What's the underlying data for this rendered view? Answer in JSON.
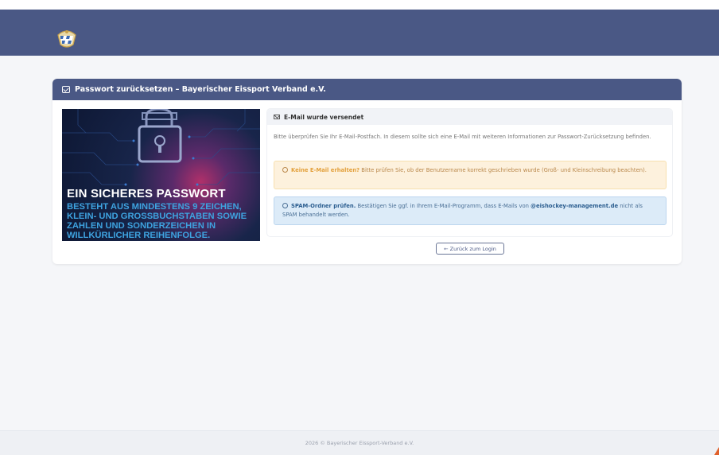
{
  "header": {
    "logo_icon": "bavarian-crest-logo"
  },
  "card": {
    "title": "Passwort zurücksetzen – Bayerischer Eissport Verband e.V.",
    "title_icon": "envelope-icon"
  },
  "banner": {
    "title": "EIN SICHERES PASSWORT",
    "subtitle": "BESTEHT AUS MINDESTENS 9 ZEICHEN, KLEIN- UND GROSSBUCHSTABEN SOWIE ZAHLEN UND SONDERZEICHEN IN WILLKÜRLICHER REIHENFOLGE."
  },
  "panel": {
    "header": "E-Mail wurde versendet",
    "body": "Bitte überprüfen Sie Ihr E-Mail-Postfach. In diesem sollte sich eine E-Mail mit weiteren Informationen zur Passwort-Zurücksetzung befinden.",
    "warning_bold": "Keine E-Mail erhalten?",
    "warning_text": "Bitte prüfen Sie, ob der Benutzername korrekt geschrieben wurde (Groß- und Kleinschreibung beachten).",
    "info_bold": "SPAM-Ordner prüfen.",
    "info_text_1": "Bestätigen Sie ggf. in Ihrem E-Mail-Programm, dass E-Mails von",
    "info_domain": "@eishockey-management.de",
    "info_text_2": "nicht als SPAM behandelt werden."
  },
  "actions": {
    "back_label": "← Zurück zum Login"
  },
  "footer": {
    "text": "2026 © Bayerischer Eissport-Verband e.V."
  },
  "colors": {
    "primary": "#4a5885",
    "warning_bg": "#fdf1dd",
    "info_bg": "#dcebf8"
  }
}
